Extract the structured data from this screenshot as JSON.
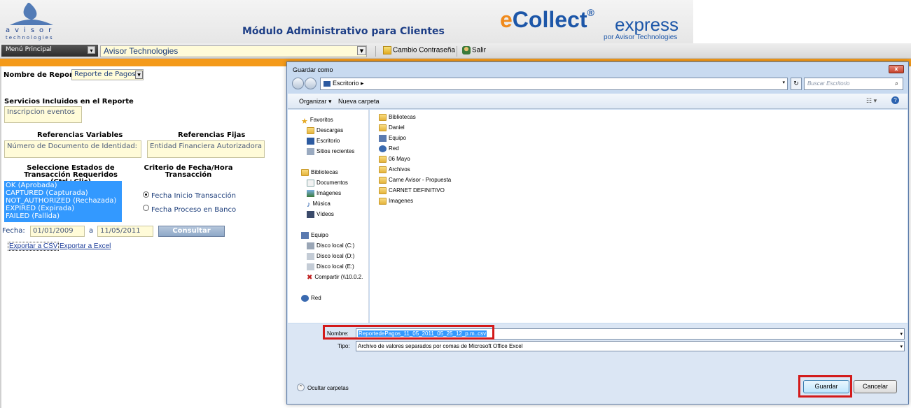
{
  "header": {
    "logo_text": "avisor",
    "logo_sub": "technologies",
    "module_title": "Módulo Administrativo para Clientes",
    "brand_main": "Collect",
    "brand_prefix": "e",
    "brand_reg": "®",
    "brand_express": "express",
    "brand_by": "por Avisor Technologies"
  },
  "menubar": {
    "menu_principal": "Menú Principal",
    "company": "Avisor Technologies",
    "change_password": "Cambio Contraseña",
    "logout": "Salir"
  },
  "form": {
    "report_label": "Nombre de Reporte:",
    "report_value": "Reporte de Pagos",
    "services_label": "Servicios Incluidos en el Reporte",
    "services_value": "Inscripcion eventos",
    "ref_var_label": "Referencias Variables",
    "ref_var_value": "Número de Documento de Identidad:",
    "ref_fix_label": "Referencias Fijas",
    "ref_fix_value": "Entidad Financiera Autorizadora",
    "estados_label": "Seleccione Estados de Transacción Requeridos (Ctrl+Clic)",
    "estados": [
      "OK (Aprobada)",
      "CAPTURED (Capturada)",
      "NOT_AUTHORIZED (Rechazada)",
      "EXPIRED (Expirada)",
      "FAILED (Fallida)"
    ],
    "criterio_label": "Criterio de Fecha/Hora Transacción",
    "criterio_options": [
      "Fecha Inicio Transacción",
      "Fecha Proceso en Banco"
    ],
    "criterio_selected": 0,
    "fecha_label": "Fecha:",
    "fecha_from": "01/01/2009",
    "fecha_sep": "a",
    "fecha_to": "11/05/2011",
    "consultar": "Consultar",
    "export_csv": "Exportar a CSV",
    "export_excel": "Exportar a Excel"
  },
  "dialog": {
    "title": "Guardar como",
    "close": "x",
    "path": "Escritorio",
    "search_placeholder": "Buscar Escritorio",
    "organize": "Organizar ▾",
    "new_folder": "Nueva carpeta",
    "nav": {
      "favorites": "Favoritos",
      "favorites_items": [
        "Descargas",
        "Escritorio",
        "Sitios recientes"
      ],
      "libraries": "Bibliotecas",
      "libraries_items": [
        "Documentos",
        "Imágenes",
        "Música",
        "Vídeos"
      ],
      "computer": "Equipo",
      "computer_items": [
        "Disco local (C:)",
        "Disco local (D:)",
        "Disco local (E:)",
        "Compartir (\\\\10.0.2."
      ],
      "network": "Red"
    },
    "files": [
      "Bibliotecas",
      "Daniel",
      "Equipo",
      "Red",
      "06 Mayo",
      "Archivos",
      "Carne Avisor - Propuesta",
      "CARNET DEFINITIVO",
      "Imagenes"
    ],
    "name_label": "Nombre:",
    "name_value": "ReportedePagos_11_05_2011_05_25_12_p.m..csv",
    "type_label": "Tipo:",
    "type_value": "Archivo de valores separados por comas de Microsoft Office Excel",
    "hide_folders": "Ocultar carpetas",
    "save": "Guardar",
    "cancel": "Cancelar"
  },
  "colors": {
    "accent_orange": "#f49a1a",
    "brand_blue": "#1c56a8",
    "highlight_red": "#d31a1a",
    "selection_blue": "#3399ff"
  }
}
